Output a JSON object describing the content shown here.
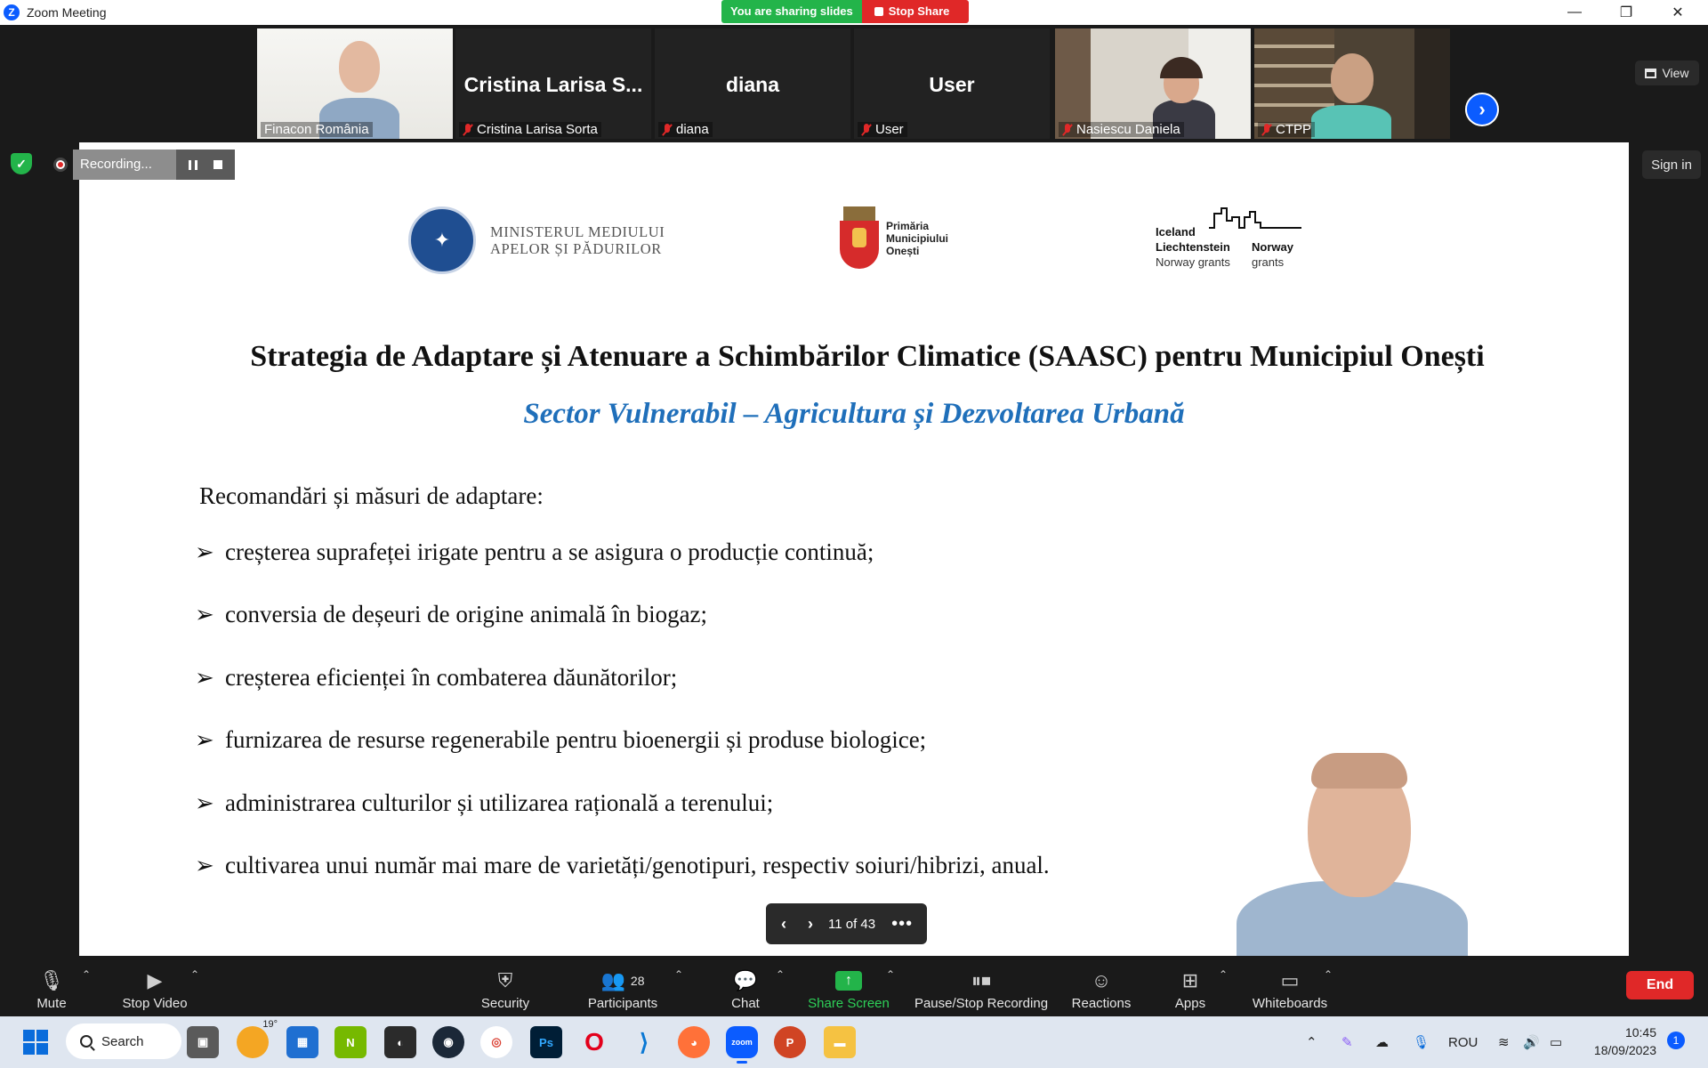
{
  "window": {
    "title": "Zoom Meeting",
    "minimize": "—",
    "restore": "❐",
    "close": "✕"
  },
  "share_banner": {
    "sharing": "You are sharing slides",
    "stop": "Stop Share"
  },
  "gallery": {
    "tiles": [
      {
        "name": "Finacon România",
        "muted": false,
        "active": true
      },
      {
        "name": "Cristina Larisa Sorta",
        "display": "Cristina  Larisa  S...",
        "muted": true
      },
      {
        "name": "diana",
        "display": "diana",
        "muted": true
      },
      {
        "name": "User",
        "display": "User",
        "muted": true
      },
      {
        "name": "Nasiescu Daniela",
        "muted": true
      },
      {
        "name": "CTPP",
        "muted": true
      }
    ],
    "view_label": "View"
  },
  "recording": {
    "label": "Recording..."
  },
  "sign_in": "Sign in",
  "slide": {
    "logos": {
      "ministry": [
        "MINISTERUL MEDIULUI",
        "APELOR ȘI PĂDURILOR"
      ],
      "primaria": [
        "Primăria",
        "Municipiului",
        "Onești"
      ],
      "eea": {
        "iceland": "Iceland",
        "liechtenstein": "Liechtenstein",
        "norway": "Norway",
        "grants": "grants",
        "norway2": "Norway",
        "grants2": "grants"
      }
    },
    "title": "Strategia de Adaptare și Atenuare a Schimbărilor Climatice (SAASC) pentru Municipiul Onești",
    "subtitle": "Sector Vulnerabil – Agricultura și Dezvoltarea Urbană",
    "intro": "Recomandări și măsuri de adaptare:",
    "bullets": [
      "creșterea suprafeței  irigate pentru a se asigura  o producție continuă;",
      "conversia  de deșeuri de origine animală  în biogaz;",
      "creșterea eficienței  în combaterea dăunătorilor;",
      "furnizarea de resurse  regenerabile pentru bioenergii  și produse biologice;",
      "administrarea  culturilor  și utilizarea rațională  a terenului;",
      "cultivarea unui  număr  mai mare de varietăți/genotipuri,  respectiv soiuri/hibrizi,  anual."
    ]
  },
  "pager": {
    "text": "11 of 43",
    "current": 11,
    "total": 43
  },
  "toolbar": {
    "mute": "Mute",
    "stop_video": "Stop Video",
    "security": "Security",
    "participants": "Participants",
    "participants_count": "28",
    "chat": "Chat",
    "share_screen": "Share Screen",
    "pause_stop_recording": "Pause/Stop Recording",
    "reactions": "Reactions",
    "apps": "Apps",
    "whiteboards": "Whiteboards",
    "end": "End"
  },
  "taskbar": {
    "search": "Search",
    "weather_temp": "19°",
    "language": "ROU",
    "time": "10:45",
    "date": "18/09/2023",
    "notifications": "1"
  },
  "colors": {
    "zoom_blue": "#0b5cff",
    "share_green": "#23b44a",
    "stop_red": "#e02828",
    "subtitle_blue": "#1f6fba"
  }
}
